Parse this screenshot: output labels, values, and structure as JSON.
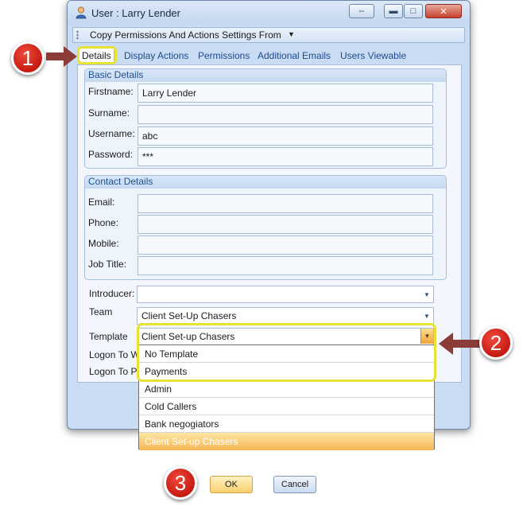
{
  "window": {
    "title": "User : Larry Lender",
    "controls": {
      "swap": "⇔",
      "minimize": "▬",
      "maximize": "□",
      "close": "✕"
    }
  },
  "toolbar": {
    "copy_label": "Copy Permissions And Actions Settings From",
    "arrow": "▼"
  },
  "tabs": [
    {
      "label": "Details",
      "active": true
    },
    {
      "label": "Display Actions"
    },
    {
      "label": "Permissions"
    },
    {
      "label": "Additional Emails"
    },
    {
      "label": "Users Viewable"
    }
  ],
  "basic_details": {
    "header": "Basic Details",
    "firstname_label": "Firstname:",
    "firstname_value": "Larry Lender",
    "surname_label": "Surname:",
    "surname_value": "",
    "username_label": "Username:",
    "username_value": "abc",
    "password_label": "Password:",
    "password_value": "***"
  },
  "contact_details": {
    "header": "Contact Details",
    "email_label": "Email:",
    "phone_label": "Phone:",
    "mobile_label": "Mobile:",
    "jobtitle_label": "Job Title:"
  },
  "misc": {
    "introducer_label": "Introducer:",
    "introducer_value": "",
    "team_label": "Team",
    "team_value": "Client Set-Up Chasers",
    "template_label": "Template",
    "template_value": "Client Set-up Chasers",
    "logon_w_label": "Logon To W",
    "logon_p_label": "Logon To P"
  },
  "template_dropdown": {
    "options": [
      "No Template",
      "Payments",
      "Admin",
      "Cold Callers",
      "Bank negogiators",
      "Client Set-up Chasers"
    ],
    "selected_index": 5
  },
  "buttons": {
    "ok": "OK",
    "cancel": "Cancel"
  },
  "callouts": [
    "1",
    "2",
    "3"
  ],
  "colors": {
    "highlight": "#e8e235",
    "callout_red": "#d22b1f",
    "arrow": "#8b3c38",
    "tab_text": "#1e4a8e"
  }
}
